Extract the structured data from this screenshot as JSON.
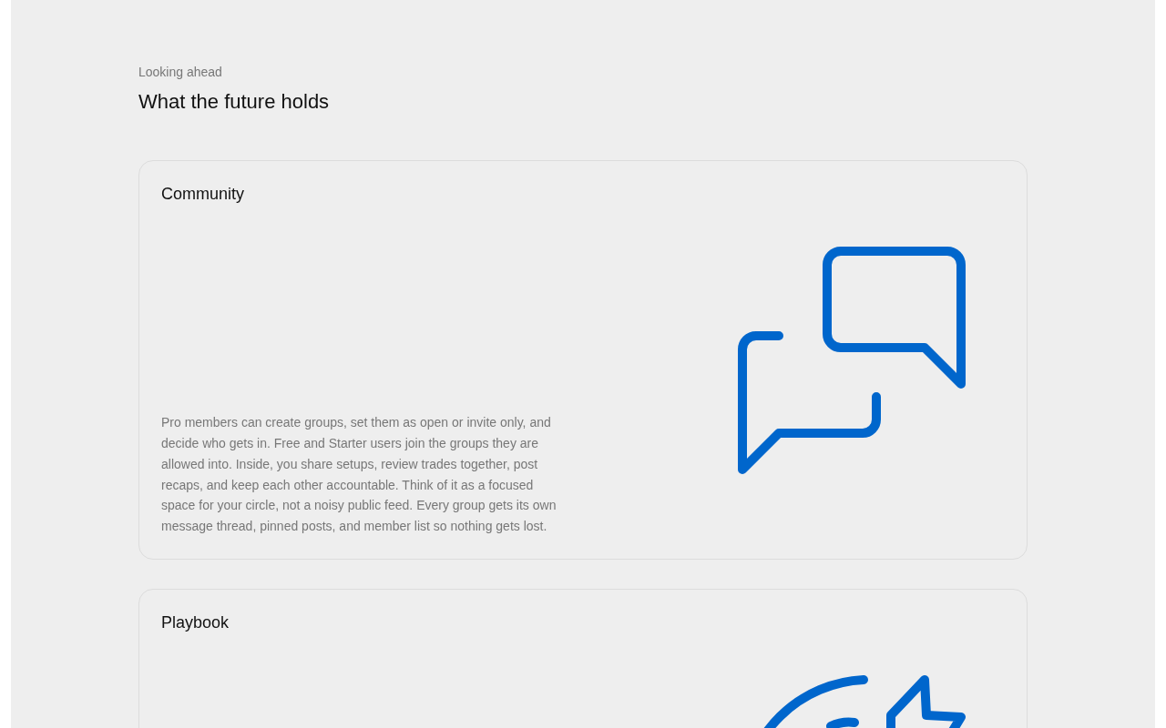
{
  "section": {
    "eyebrow": "Looking ahead",
    "title": "What the future holds"
  },
  "features": [
    {
      "kind": "community",
      "title": "Community",
      "description": "Pro members can create groups, set them as open or invite only, and decide who gets in. Free and Starter users join the groups they are allowed into. Inside, you share setups, review trades together, post recaps, and keep each other accountable. Think of it as a focused space for your circle, not a noisy public feed. Every group gets its own message thread, pinned posts, and member list so nothing gets lost."
    },
    {
      "kind": "playbook",
      "title": "Playbook"
    }
  ]
}
